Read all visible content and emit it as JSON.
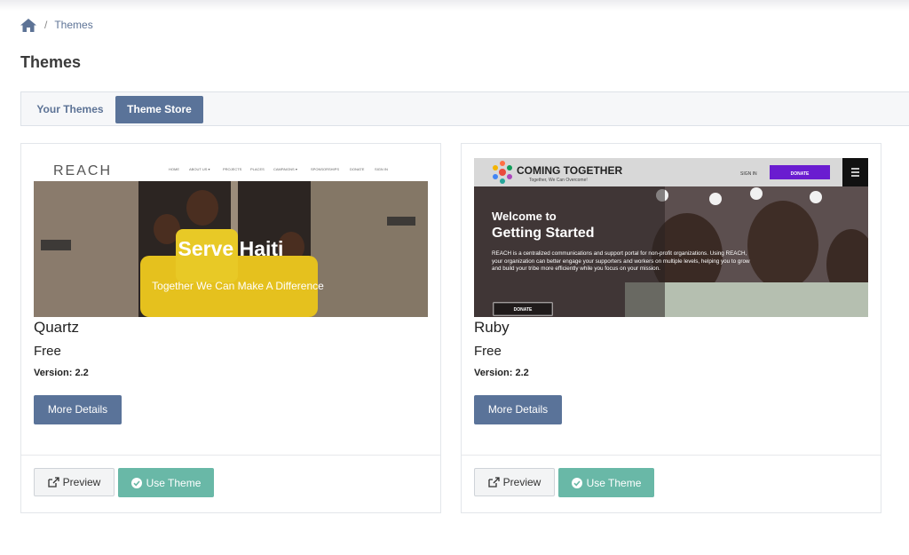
{
  "breadcrumb": {
    "home_icon": "home-icon",
    "current": "Themes"
  },
  "page": {
    "title": "Themes"
  },
  "tabs": [
    {
      "label": "Your Themes",
      "active": false
    },
    {
      "label": "Theme Store",
      "active": true
    }
  ],
  "colors": {
    "primary": "#5a7399",
    "success": "#69b8a7",
    "link": "#5d7396"
  },
  "themes": [
    {
      "name": "Quartz",
      "price": "Free",
      "version": "Version: 2.2",
      "preview_image": {
        "logo": "REACH",
        "nav": [
          "HOME",
          "ABOUT US ▾",
          "PROJECTS",
          "PLACES",
          "CAMPAIGNS ▾",
          "SPONSORSHIPS",
          "DONATE",
          "SIGN IN"
        ],
        "headline": "Serve Haiti",
        "tagline": "Together We Can Make A Difference"
      },
      "more_details_label": "More Details",
      "preview_label": "Preview",
      "use_label": "Use Theme"
    },
    {
      "name": "Ruby",
      "price": "Free",
      "version": "Version: 2.2",
      "preview_image": {
        "logo": "COMING TOGETHER",
        "logo_sub": "Together, We Can Overcome!",
        "sign_in": "SIGN IN",
        "donate_top": "DONATE",
        "headline_1": "Welcome to",
        "headline_2": "Getting Started",
        "body": "REACH is a centralized communications and support portal for non-profit organizations. Using REACH, your organization can better engage your supporters and workers on multiple levels, helping you to grow and build your tribe more efficiently while you focus on your mission.",
        "donate_bottom": "DONATE"
      },
      "more_details_label": "More Details",
      "preview_label": "Preview",
      "use_label": "Use Theme"
    }
  ]
}
